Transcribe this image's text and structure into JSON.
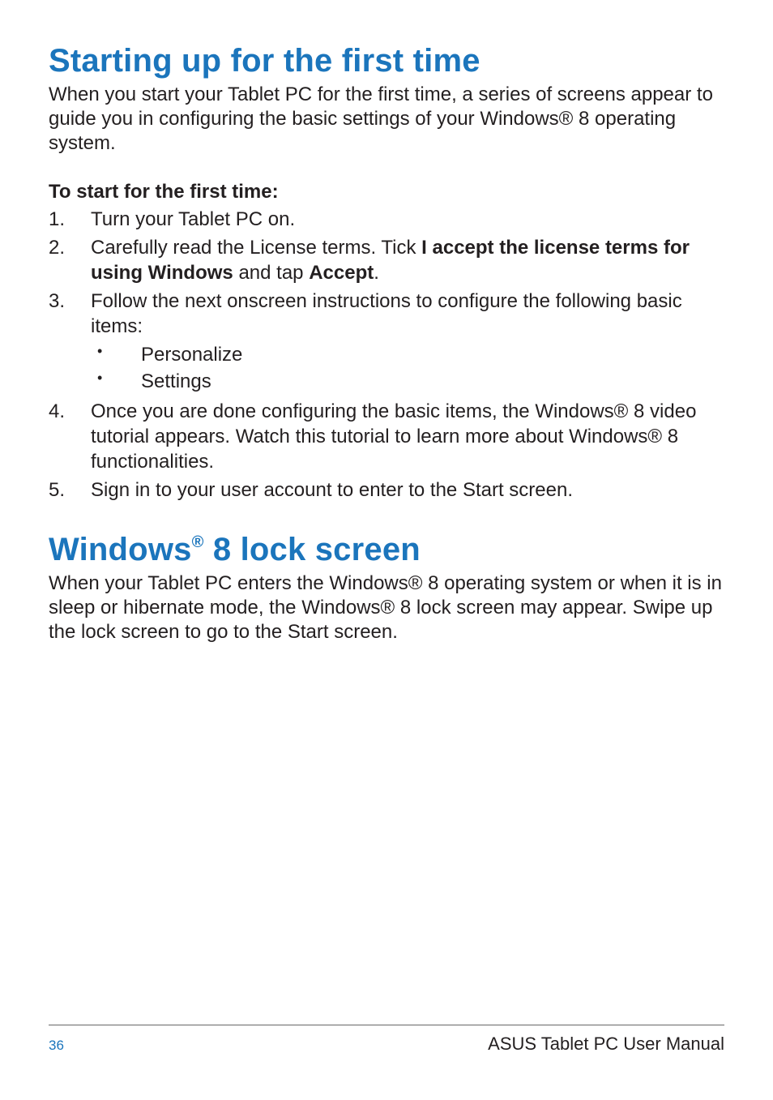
{
  "section1": {
    "title": "Starting up for the first time",
    "intro": "When you start your Tablet PC for the first time, a series of screens appear to guide you in configuring the basic settings of your Windows® 8 operating system.",
    "subhead": "To start for the first time:",
    "steps": {
      "s1": "Turn your Tablet PC on.",
      "s2_pre": "Carefully read the License terms. Tick ",
      "s2_bold1": "I accept the license terms for using Windows",
      "s2_mid": " and tap ",
      "s2_bold2": "Accept",
      "s2_post": ".",
      "s3": "Follow the next onscreen instructions to configure the following basic items:",
      "s3_bullets": {
        "b1": "Personalize",
        "b2": "Settings"
      },
      "s4": "Once you are done configuring the basic items, the Windows® 8 video tutorial appears. Watch this tutorial to learn more about Windows® 8 functionalities.",
      "s5": "Sign in to your user account to enter to the Start screen."
    }
  },
  "section2": {
    "title_pre": "Windows",
    "title_sup": "®",
    "title_post": " 8 lock screen",
    "intro": "When your Tablet PC enters the Windows® 8 operating system or when it is in sleep or hibernate mode, the Windows® 8 lock screen may appear. Swipe up the lock screen to go to the Start screen."
  },
  "footer": {
    "page": "36",
    "title": "ASUS Tablet PC User Manual"
  }
}
